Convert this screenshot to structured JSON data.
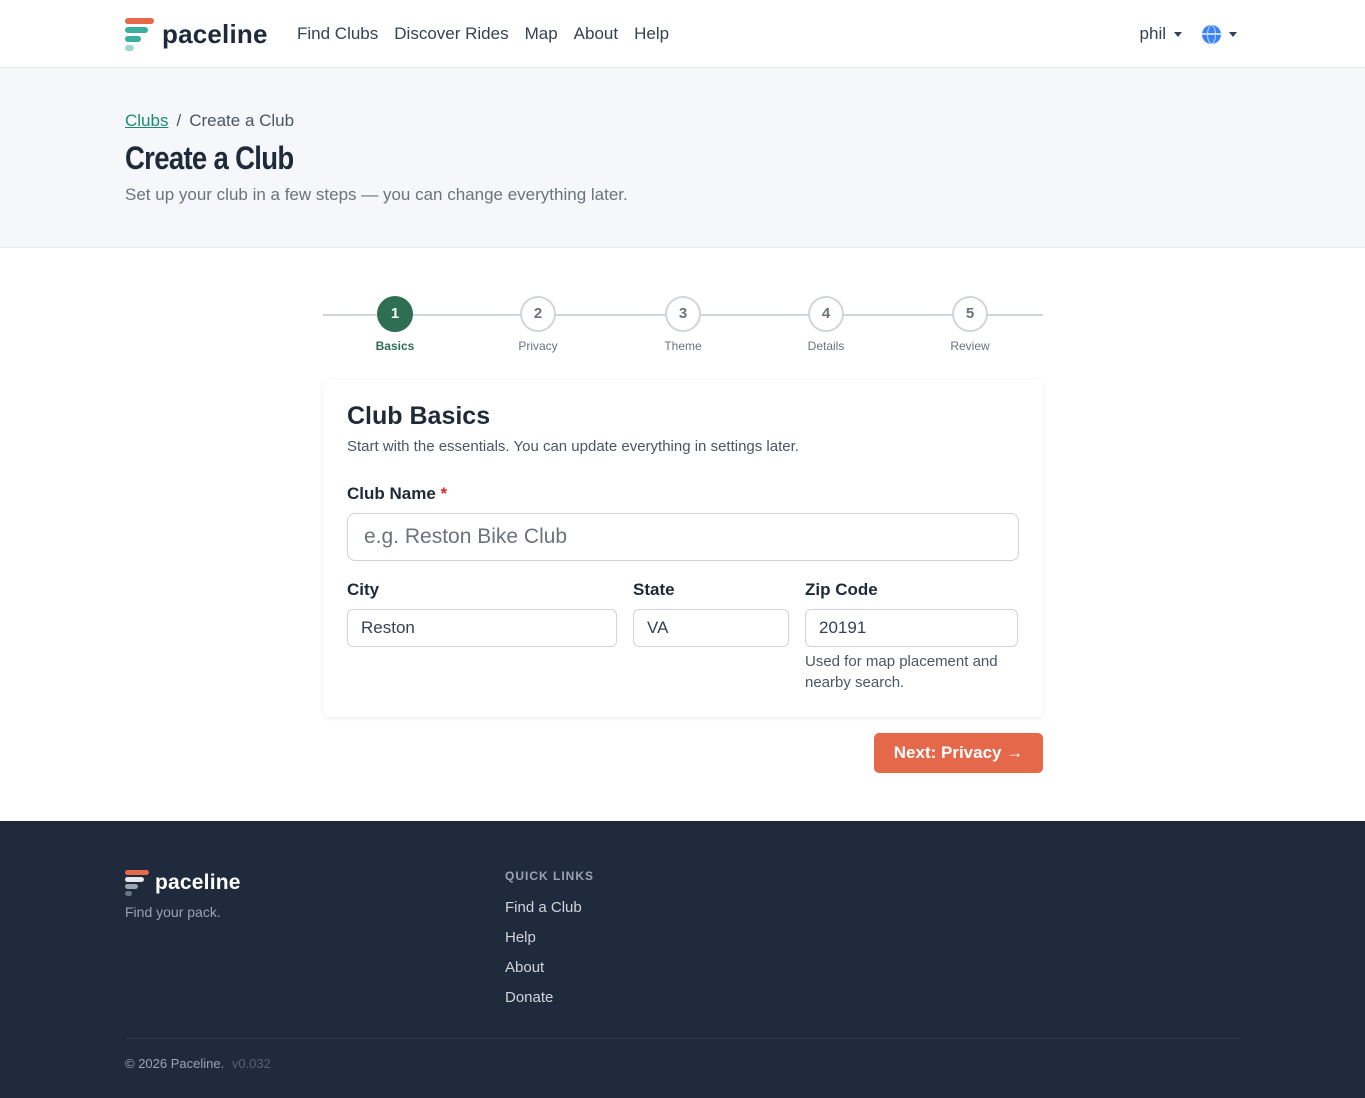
{
  "nav": {
    "brand": "paceline",
    "links": [
      "Find Clubs",
      "Discover Rides",
      "Map",
      "About",
      "Help"
    ],
    "user": "phil",
    "lang_icon": "globe-icon"
  },
  "header": {
    "breadcrumb_link": "Clubs",
    "breadcrumb_sep": "/",
    "breadcrumb_current": "Create a Club",
    "title": "Create a Club",
    "subtitle": "Set up your club in a few steps — you can change everything later."
  },
  "stepper": {
    "active_step": 1,
    "steps": [
      {
        "number": "1",
        "label": "Basics"
      },
      {
        "number": "2",
        "label": "Privacy"
      },
      {
        "number": "3",
        "label": "Theme"
      },
      {
        "number": "4",
        "label": "Details"
      },
      {
        "number": "5",
        "label": "Review"
      }
    ]
  },
  "form": {
    "title": "Club Basics",
    "description": "Start with the essentials. You can update everything in settings later.",
    "club_name": {
      "label": "Club Name",
      "required_mark": "*",
      "placeholder": "e.g. Reston Bike Club",
      "value": ""
    },
    "city": {
      "label": "City",
      "value": "Reston"
    },
    "state": {
      "label": "State",
      "value": "VA"
    },
    "zip": {
      "label": "Zip Code",
      "value": "20191",
      "help": "Used for map placement and nearby search."
    }
  },
  "actions": {
    "next_label": "Next: Privacy →"
  },
  "footer": {
    "brand": "paceline",
    "tagline": "Find your pack.",
    "quick_links_heading": "QUICK LINKS",
    "quick_links": [
      "Find a Club",
      "Help",
      "About",
      "Donate"
    ],
    "copyright": "© 2026 Paceline.",
    "version": "v0.032"
  },
  "colors": {
    "accent": "#e6684a",
    "primary_green": "#2e6e52",
    "link": "#1d8a74",
    "footer_bg": "#1f2a3c",
    "header_bg": "#f5f7fa"
  }
}
